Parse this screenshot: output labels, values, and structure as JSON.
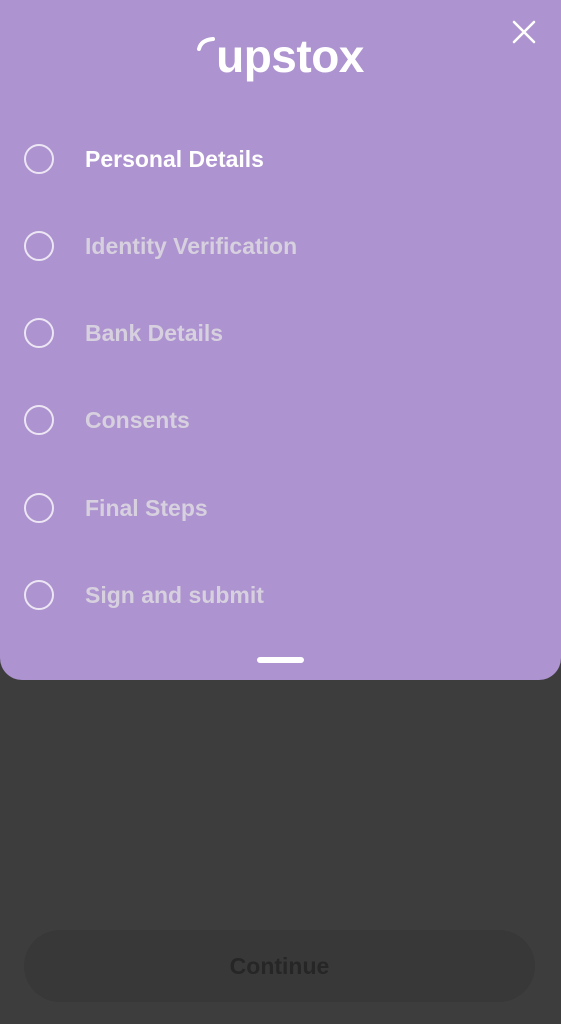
{
  "brand": {
    "logo_text": "upstox"
  },
  "icons": {
    "close": "close-icon",
    "step": "radio-circle-icon"
  },
  "steps": [
    {
      "label": "Personal Details",
      "active": true
    },
    {
      "label": "Identity Verification",
      "active": false
    },
    {
      "label": "Bank Details",
      "active": false
    },
    {
      "label": "Consents",
      "active": false
    },
    {
      "label": "Final Steps",
      "active": false
    },
    {
      "label": "Sign and submit",
      "active": false
    }
  ],
  "footer": {
    "continue_label": "Continue"
  },
  "colors": {
    "sheet": "#ad93cf",
    "backdrop": "#3d3d3d",
    "active_text": "#ffffff",
    "inactive_text": "#d7d0df"
  }
}
